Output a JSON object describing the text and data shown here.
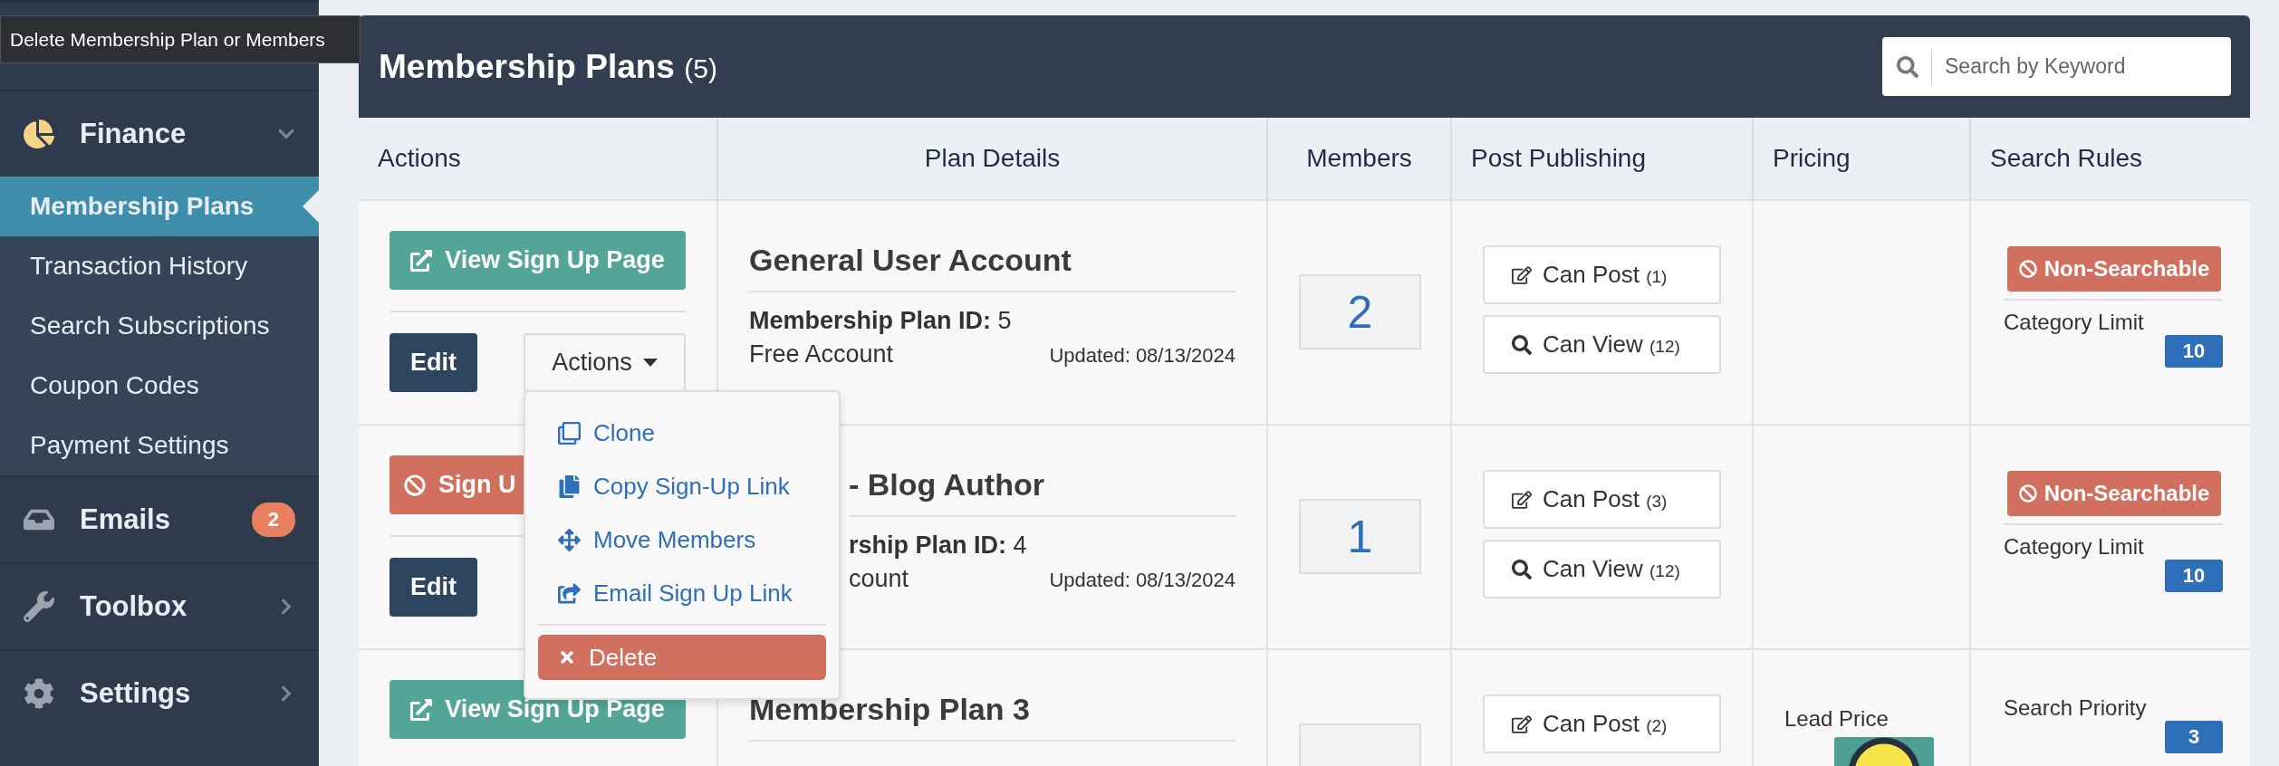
{
  "tooltip": "Delete Membership Plan or Members",
  "sidebar": {
    "sections": [
      {
        "label": "Finance",
        "kind": "group",
        "expanded": true,
        "children": [
          {
            "label": "Membership Plans",
            "selected": true
          },
          {
            "label": "Transaction History",
            "selected": false
          },
          {
            "label": "Search Subscriptions",
            "selected": false
          },
          {
            "label": "Coupon Codes",
            "selected": false
          },
          {
            "label": "Payment Settings",
            "selected": false
          }
        ]
      },
      {
        "label": "Emails",
        "kind": "link",
        "badge": "2"
      },
      {
        "label": "Toolbox",
        "kind": "group",
        "expanded": false
      },
      {
        "label": "Settings",
        "kind": "group",
        "expanded": false
      }
    ]
  },
  "panel": {
    "title": "Membership Plans",
    "count": "(5)",
    "search": {
      "placeholder": "Search by Keyword"
    }
  },
  "table": {
    "columns": [
      "Actions",
      "Plan Details",
      "Members",
      "Post Publishing",
      "Pricing",
      "Search Rules"
    ],
    "rows": [
      {
        "partly_hidden": false,
        "signup": {
          "label": "View Sign Up Page",
          "kind": "view"
        },
        "edit": "Edit",
        "menu": {
          "label": "Actions",
          "expanded": true,
          "items": [
            {
              "label": "Clone",
              "kind": "link"
            },
            {
              "label": "Copy Sign-Up Link",
              "kind": "link"
            },
            {
              "label": "Move Members",
              "kind": "link"
            },
            {
              "label": "Email Sign Up Link",
              "kind": "link"
            },
            {
              "label": "Delete",
              "kind": "danger"
            }
          ]
        },
        "name": "General User Account",
        "id_label": "Membership Plan ID:",
        "id": "5",
        "type": "Free Account",
        "updated": "Updated: 08/13/2024",
        "members": "2",
        "post": [
          {
            "label": "Can Post",
            "count": "(1)",
            "kind": "post"
          },
          {
            "label": "Can View",
            "count": "(12)",
            "kind": "view"
          }
        ],
        "search_rules": [
          {
            "kind": "flag",
            "label": "Non-Searchable"
          },
          {
            "kind": "limit",
            "label": "Category Limit",
            "value": "10"
          }
        ]
      },
      {
        "partly_hidden": true,
        "signup": {
          "label": "Sign U",
          "kind": "blocked"
        },
        "edit": "Edit",
        "name": "- Blog Author",
        "id_label": "rship Plan ID:",
        "id": "4",
        "type": "count",
        "updated": "Updated: 08/13/2024",
        "members": "1",
        "post": [
          {
            "label": "Can Post",
            "count": "(3)",
            "kind": "post"
          },
          {
            "label": "Can View",
            "count": "(12)",
            "kind": "view"
          }
        ],
        "search_rules": [
          {
            "kind": "flag",
            "label": "Non-Searchable"
          },
          {
            "kind": "limit",
            "label": "Category Limit",
            "value": "10"
          }
        ]
      },
      {
        "partly_hidden": false,
        "signup": {
          "label": "View Sign Up Page",
          "kind": "view"
        },
        "name": "Membership Plan 3",
        "post": [
          {
            "label": "Can Post",
            "count": "(2)",
            "kind": "post"
          }
        ],
        "pricing": [
          {
            "kind": "lead",
            "label": "Lead Price"
          }
        ],
        "search_rules": [
          {
            "kind": "limit",
            "label": "Search Priority",
            "value": "3"
          }
        ]
      }
    ]
  }
}
